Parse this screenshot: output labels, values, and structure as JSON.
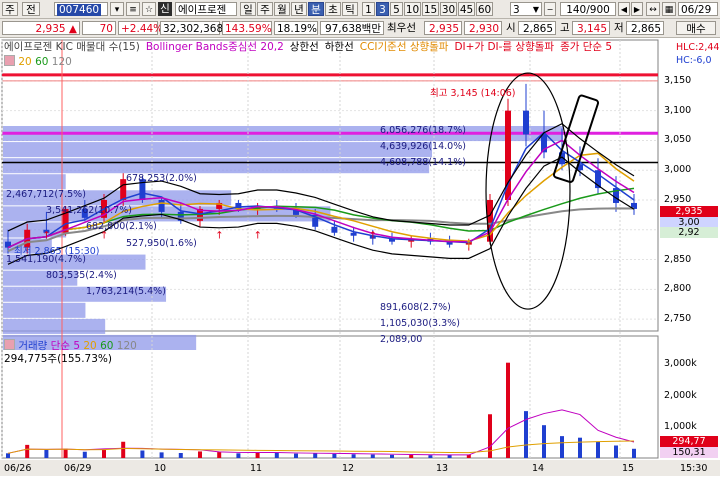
{
  "toolbar": {
    "menu_label": "주",
    "prev_label": "전",
    "code": "007460",
    "sin_badge": "신",
    "stock_name": "에이프로젠",
    "period_tabs": [
      "일",
      "주",
      "월",
      "년",
      "분",
      "초",
      "틱"
    ],
    "active_period": "분",
    "intervals": [
      "1",
      "3",
      "5",
      "10",
      "15",
      "30",
      "45",
      "60"
    ],
    "active_interval": "3",
    "count_value": "3",
    "page_value": "140/900",
    "date_value": "06/29"
  },
  "stats": {
    "price": "2,935",
    "change": "70",
    "change_pct": "+2.44%",
    "volume": "32,302,368",
    "turnover_pct": "143.59%",
    "vol_ratio": "18.19%",
    "amount": "97,638백만",
    "best_label": "최우선",
    "best_ask": "2,935",
    "best_bid": "2,930",
    "open_label": "시",
    "open": "2,865",
    "high_label": "고",
    "high": "3,145",
    "low_label": "저",
    "low": "2,865"
  },
  "price_panel": {
    "legend": [
      {
        "text": "에이프로젠 KIC 매물대 수(15)",
        "color": "#444444"
      },
      {
        "text": "Bollinger Bands중심선 20,2",
        "color": "#c000c0"
      },
      {
        "text": "상한선",
        "color": "#000000"
      },
      {
        "text": "하한선",
        "color": "#000000"
      },
      {
        "text": "CCI기준선 상향돌파",
        "color": "#e08a00"
      },
      {
        "text": "DI+가 DI-를 상향돌파",
        "color": "#e0001a"
      },
      {
        "text": "종가 단순 5",
        "color": "#e0001a"
      }
    ],
    "ma_legend": [
      "20",
      "60",
      "120"
    ],
    "hlc_label": "HLC:2,44",
    "hlc_label2": "HC:-6,0",
    "max_label": "최고 3,145 (14:06)",
    "min_label": "최저 2,865 (15:30)",
    "profile": [
      {
        "label": "6,056,276(18.7%)",
        "value": 6056276
      },
      {
        "label": "4,639,926(14.0%)",
        "value": 4639926
      },
      {
        "label": "4,608,788(14.1%)",
        "value": 4608788
      },
      {
        "label": "678,253(2.0%)",
        "value": 678253
      },
      {
        "label": "2,467,712(7.5%)",
        "value": 2467712
      },
      {
        "label": "3,541,262(10.7%)",
        "value": 3541262
      },
      {
        "label": "682,800(2.1%)",
        "value": 682800
      },
      {
        "label": "527,950(1.6%)",
        "value": 527950
      },
      {
        "label": "1,541,190(4.7%)",
        "value": 1541190
      },
      {
        "label": "803,535(2.4%)",
        "value": 803535
      },
      {
        "label": "1,763,214(5.4%)",
        "value": 1763214
      },
      {
        "label": "891,608(2.7%)",
        "value": 891608
      },
      {
        "label": "1,105,030(3.3%)",
        "value": 1105030
      },
      {
        "label": "2,089,00",
        "value": 2089000
      }
    ],
    "y_ticks": [
      "3,150",
      "3,100",
      "3,050",
      "3,000",
      "2,950",
      "2,900",
      "2,850",
      "2,800",
      "2,750"
    ],
    "current_price_tag": "2,935",
    "tag2": "3,00",
    "tag3": "2,92"
  },
  "volume_panel": {
    "legend_title": "거래량",
    "legend_ma": "단순 5",
    "legend_periods": [
      "20",
      "60",
      "120"
    ],
    "value_label": "294,775주(155.73%)",
    "y_ticks": [
      "3,000k",
      "2,000k",
      "1,000k"
    ],
    "current_tag": "294,77",
    "tag2": "150,31"
  },
  "x_axis": {
    "labels": [
      "06/26",
      "06/29",
      "10",
      "11",
      "12",
      "13",
      "14",
      "15",
      "15:30"
    ]
  },
  "colors": {
    "up": "#e0001a",
    "down": "#1f3fd0",
    "profile": "#8f98ea",
    "bollinger_mid": "#c000c0",
    "resistance": "#ee1133"
  },
  "chart_data": {
    "type": "candlestick",
    "title": "",
    "ylabel": "",
    "ylim": [
      2730,
      3175
    ],
    "x": [
      "06/26",
      "06/29",
      "10",
      "11",
      "12",
      "13",
      "14",
      "15"
    ],
    "candles": [
      [
        2880,
        2900,
        2860,
        2870
      ],
      [
        2870,
        2910,
        2860,
        2900
      ],
      [
        2900,
        2930,
        2885,
        2895
      ],
      [
        2895,
        2940,
        2890,
        2935
      ],
      [
        2935,
        2950,
        2915,
        2920
      ],
      [
        2920,
        2960,
        2910,
        2950
      ],
      [
        2950,
        2995,
        2940,
        2985
      ],
      [
        2985,
        2990,
        2945,
        2950
      ],
      [
        2950,
        2955,
        2920,
        2930
      ],
      [
        2930,
        2945,
        2910,
        2915
      ],
      [
        2915,
        2940,
        2905,
        2935
      ],
      [
        2935,
        2950,
        2925,
        2945
      ],
      [
        2945,
        2950,
        2930,
        2935
      ],
      [
        2935,
        2945,
        2925,
        2940
      ],
      [
        2940,
        2950,
        2930,
        2935
      ],
      [
        2935,
        2945,
        2920,
        2925
      ],
      [
        2925,
        2935,
        2900,
        2905
      ],
      [
        2905,
        2915,
        2890,
        2895
      ],
      [
        2895,
        2905,
        2880,
        2890
      ],
      [
        2890,
        2900,
        2875,
        2885
      ],
      [
        2885,
        2895,
        2875,
        2880
      ],
      [
        2880,
        2890,
        2870,
        2885
      ],
      [
        2885,
        2895,
        2875,
        2880
      ],
      [
        2880,
        2890,
        2870,
        2875
      ],
      [
        2875,
        2885,
        2865,
        2880
      ],
      [
        2880,
        2960,
        2875,
        2950
      ],
      [
        2950,
        3120,
        2940,
        3100
      ],
      [
        3100,
        3145,
        3040,
        3060
      ],
      [
        3060,
        3100,
        3020,
        3030
      ],
      [
        3030,
        3070,
        3000,
        3010
      ],
      [
        3010,
        3040,
        2990,
        3000
      ],
      [
        3000,
        3020,
        2960,
        2970
      ],
      [
        2970,
        2990,
        2930,
        2945
      ],
      [
        2945,
        2960,
        2925,
        2935
      ]
    ],
    "volume": [
      150,
      420,
      260,
      300,
      200,
      280,
      520,
      240,
      180,
      160,
      210,
      190,
      150,
      170,
      160,
      140,
      150,
      130,
      120,
      110,
      100,
      95,
      90,
      100,
      110,
      1400,
      3050,
      1500,
      1050,
      700,
      650,
      520,
      400,
      295
    ]
  }
}
